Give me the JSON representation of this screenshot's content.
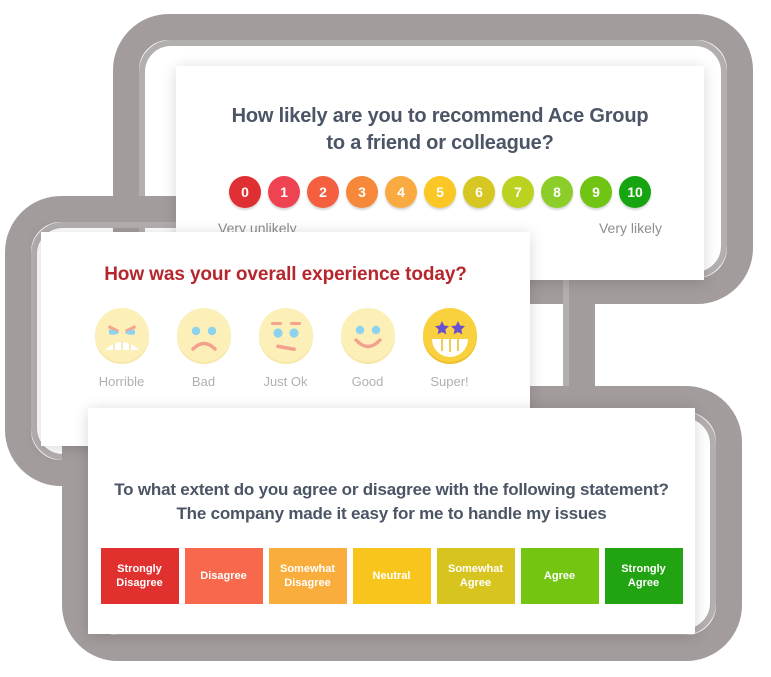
{
  "nps_card": {
    "title_line1": "How likely are you to recommend Ace Group",
    "title_line2": "to a friend or colleague?",
    "left_label": "Very unlikely",
    "right_label": "Very likely",
    "scale": [
      {
        "value": "0",
        "color": "#e02f32"
      },
      {
        "value": "1",
        "color": "#ef4352"
      },
      {
        "value": "2",
        "color": "#f4603f"
      },
      {
        "value": "3",
        "color": "#f6883a"
      },
      {
        "value": "4",
        "color": "#f9ab42"
      },
      {
        "value": "5",
        "color": "#fbc724"
      },
      {
        "value": "6",
        "color": "#d7c723"
      },
      {
        "value": "7",
        "color": "#bcd221"
      },
      {
        "value": "8",
        "color": "#8dcd2a"
      },
      {
        "value": "9",
        "color": "#6fc512"
      },
      {
        "value": "10",
        "color": "#17a411"
      }
    ]
  },
  "smiley_card": {
    "title": "How was your overall experience today?",
    "faces": [
      {
        "label": "Horrible",
        "icon": "angry-face-icon",
        "face_color": "#fcefb7",
        "mood": "angry"
      },
      {
        "label": "Bad",
        "icon": "sad-face-icon",
        "face_color": "#fcefb7",
        "mood": "sad"
      },
      {
        "label": "Just Ok",
        "icon": "neutral-face-icon",
        "face_color": "#fcefb7",
        "mood": "neutral"
      },
      {
        "label": "Good",
        "icon": "happy-face-icon",
        "face_color": "#fcefb7",
        "mood": "happy"
      },
      {
        "label": "Super!",
        "icon": "star-eyes-face-icon",
        "face_color": "#f9d13f",
        "mood": "super"
      }
    ]
  },
  "agree_card": {
    "title_line1": "To what extent do you agree or disagree with the following statement?",
    "title_line2": "The company made it easy for me to handle my issues",
    "options": [
      {
        "label_line1": "Strongly",
        "label_line2": "Disagree",
        "color": "#e0312f"
      },
      {
        "label_line1": "Disagree",
        "label_line2": "",
        "color": "#f7684c"
      },
      {
        "label_line1": "Somewhat",
        "label_line2": "Disagree",
        "color": "#f9ad3c"
      },
      {
        "label_line1": "Neutral",
        "label_line2": "",
        "color": "#f8c51c"
      },
      {
        "label_line1": "Somewhat",
        "label_line2": "Agree",
        "color": "#d8c41f"
      },
      {
        "label_line1": "Agree",
        "label_line2": "",
        "color": "#74c511"
      },
      {
        "label_line1": "Strongly",
        "label_line2": "Agree",
        "color": "#22a312"
      }
    ]
  },
  "frames": {
    "outer_color": "#a39c9c",
    "inner_color": "#b4afaf"
  }
}
